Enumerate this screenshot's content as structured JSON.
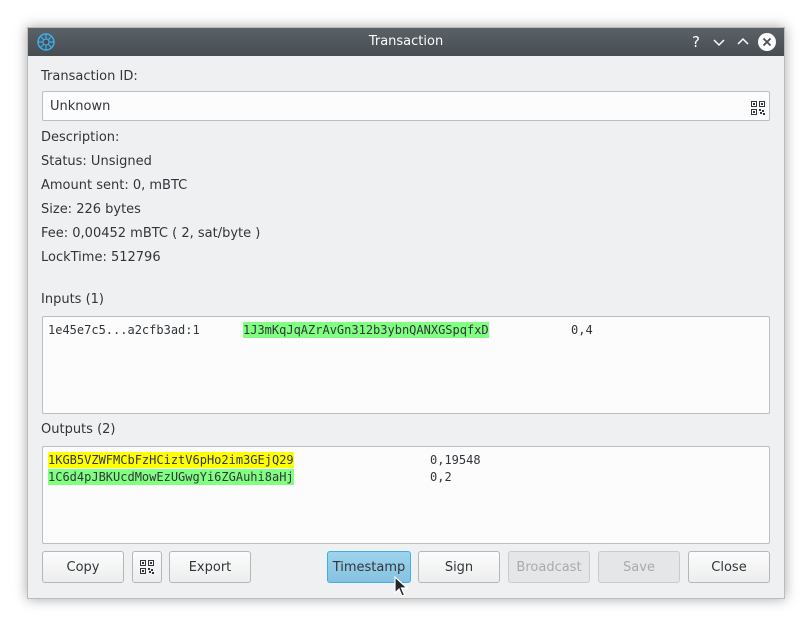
{
  "window": {
    "title": "Transaction",
    "help_label": "?"
  },
  "details": {
    "txid_label": "Transaction ID:",
    "txid_value": "Unknown",
    "description": "Description:",
    "status": "Status: Unsigned",
    "amount": "Amount sent: 0, mBTC",
    "size": "Size: 226 bytes",
    "fee": "Fee: 0,00452 mBTC  ( 2, sat/byte )",
    "locktime": "LockTime: 512796"
  },
  "inputs": {
    "label": "Inputs (1)",
    "rows": [
      {
        "prevout": "1e45e7c5...a2cfb3ad:1",
        "address": "1J3mKqJqAZrAvGn312b3ybnQANXGSpqfxD",
        "amount": "0,4",
        "highlight": "#80ff80"
      }
    ]
  },
  "outputs": {
    "label": "Outputs (2)",
    "rows": [
      {
        "address": "1KGB5VZWFMCbFzHCiztV6pHo2im3GEjQ29",
        "amount": "0,19548",
        "highlight": "#ffff00"
      },
      {
        "address": "1C6d4pJBKUcdMowEzUGwgYi6ZGAuhi8aHj",
        "amount": "0,2",
        "highlight": "#80ff80"
      }
    ]
  },
  "buttons": {
    "copy": "Copy",
    "export": "Export",
    "timestamp": "Timestamp",
    "sign": "Sign",
    "broadcast": "Broadcast",
    "save": "Save",
    "close": "Close"
  },
  "colors": {
    "titlebar": "#474d52",
    "accent": "#3daee9",
    "highlight_mine": "#80ff80",
    "highlight_change": "#ffff00"
  }
}
